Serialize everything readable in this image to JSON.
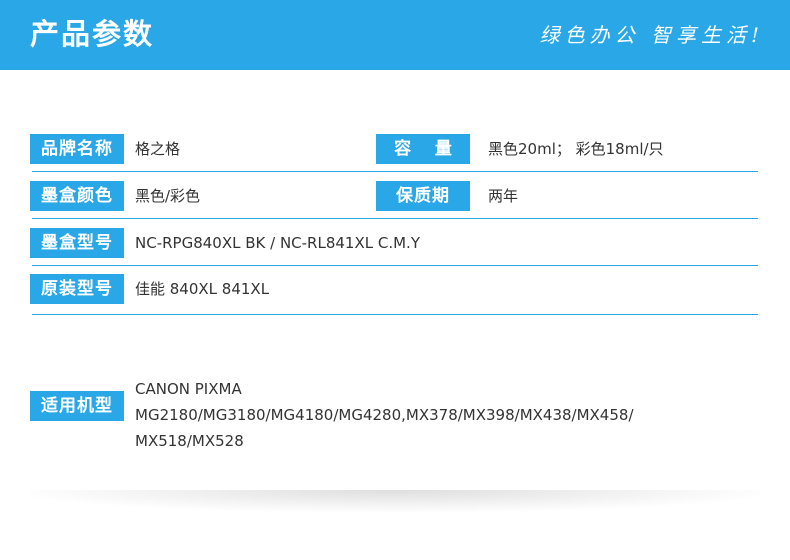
{
  "header": {
    "title": "产品参数",
    "slogan": "绿色办公 智享生活!"
  },
  "rows": [
    {
      "label": "品牌名称",
      "value": "格之格",
      "right_label": "容    量",
      "right_value": "黑色20ml； 彩色18ml/只"
    },
    {
      "label": "墨盒颜色",
      "value": "黑色/彩色",
      "right_label": "保质期",
      "right_value": "两年"
    },
    {
      "label": "墨盒型号",
      "value": "NC-RPG840XL BK  /  NC-RL841XL C.M.Y"
    },
    {
      "label": "原装型号",
      "value": "佳能 840XL 841XL"
    },
    {
      "label": "适用机型",
      "value_line1": "CANON PIXMA MG2180/MG3180/MG4180/MG4280,MX378/MX398/MX438/MX458/",
      "value_line2": "MX518/MX528"
    }
  ],
  "colors": {
    "accent": "#29a7e6",
    "text": "#333333",
    "background": "#ffffff"
  }
}
